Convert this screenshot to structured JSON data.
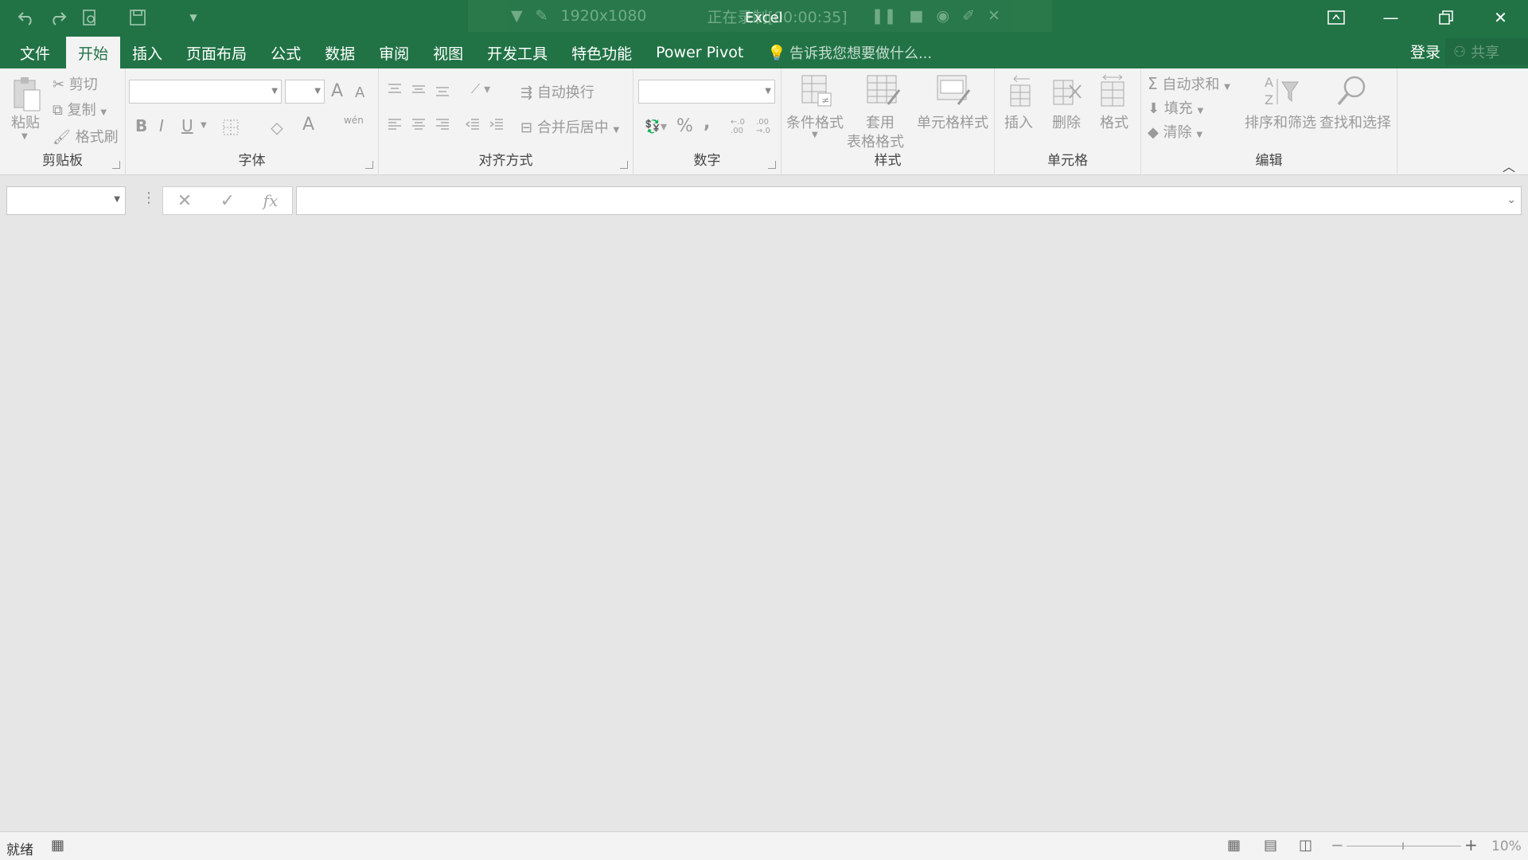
{
  "window": {
    "title": "Excel",
    "recording": {
      "resolution": "1920x1080",
      "status": "正在录制[00:00:35]"
    }
  },
  "tabs": [
    {
      "label": "文件"
    },
    {
      "label": "开始"
    },
    {
      "label": "插入"
    },
    {
      "label": "页面布局"
    },
    {
      "label": "公式"
    },
    {
      "label": "数据"
    },
    {
      "label": "审阅"
    },
    {
      "label": "视图"
    },
    {
      "label": "开发工具"
    },
    {
      "label": "特色功能"
    },
    {
      "label": "Power Pivot"
    }
  ],
  "tell_me": "告诉我您想要做什么...",
  "account": {
    "login": "登录",
    "share": "共享"
  },
  "ribbon": {
    "clipboard": {
      "label": "剪贴板",
      "paste": "粘贴",
      "cut": "剪切",
      "copy": "复制",
      "format_painter": "格式刷"
    },
    "font": {
      "label": "字体",
      "bold": "B",
      "italic": "I",
      "underline": "U",
      "grow": "A",
      "shrink": "A",
      "font_color": "A",
      "phonetic": "wén"
    },
    "alignment": {
      "label": "对齐方式",
      "wrap": "自动换行",
      "merge": "合并后居中"
    },
    "number": {
      "label": "数字",
      "percent": "%",
      "comma": ","
    },
    "styles": {
      "label": "样式",
      "conditional": "条件格式",
      "table1": "套用",
      "table2": "表格格式",
      "cell_styles": "单元格样式"
    },
    "cells": {
      "label": "单元格",
      "insert": "插入",
      "delete": "删除",
      "format": "格式"
    },
    "editing": {
      "label": "编辑",
      "autosum": "自动求和",
      "fill": "填充",
      "clear": "清除",
      "sort": "排序和筛选",
      "find": "查找和选择"
    }
  },
  "formula_bar": {
    "fx": "fx"
  },
  "status": {
    "ready": "就绪",
    "zoom": "10%"
  }
}
